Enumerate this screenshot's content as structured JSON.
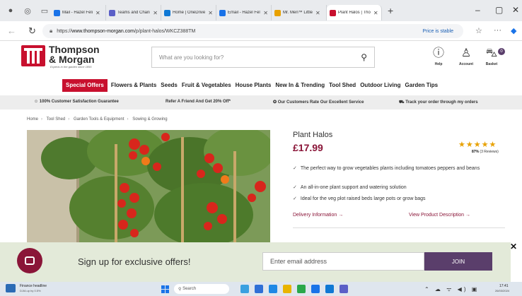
{
  "browser": {
    "tabs": [
      {
        "label": "Mail - Hazel Feli",
        "favicon_color": "#1a73e8",
        "active": false
      },
      {
        "label": "Teams and Chann",
        "favicon_color": "#5b5fc7",
        "active": false
      },
      {
        "label": "Home | OneDrive",
        "favicon_color": "#0f78d4",
        "active": false
      },
      {
        "label": "Email - Hazel Feli",
        "favicon_color": "#1a73e8",
        "active": false
      },
      {
        "label": "Mr. Men™ Little",
        "favicon_color": "#e8a100",
        "active": false
      },
      {
        "label": "Plant Halos | Tho",
        "favicon_color": "#c8102e",
        "active": true
      }
    ],
    "url_prefix": "https://",
    "url_domain": "www.thompson-morgan.com",
    "url_path": "/p/plant-halos/WKCZ388TM",
    "price_note": "Price is stable"
  },
  "site": {
    "brand_line1": "Thompson",
    "brand_line2": "& Morgan",
    "tagline": "Experts in the garden since 1855",
    "search_placeholder": "What are you looking for?",
    "header_icons": [
      {
        "label": "Help",
        "icon": "help-icon"
      },
      {
        "label": "Account",
        "icon": "account-icon"
      },
      {
        "label": "Basket",
        "icon": "basket-icon"
      }
    ],
    "basket_count": "0",
    "nav": [
      "Special Offers",
      "Flowers & Plants",
      "Seeds",
      "Fruit & Vegetables",
      "House Plants",
      "New In & Trending",
      "Tool Shed",
      "Outdoor Living",
      "Garden Tips"
    ],
    "benefits": [
      "100% Customer Satisfaction Guarantee",
      "Refer A Friend And Get 20% Off*",
      "Our Customers Rate Our Excellent Service",
      "Track your order through my orders"
    ],
    "breadcrumbs": [
      "Home",
      "Tool Shed",
      "Garden Tools & Equipment",
      "Sowing & Growing"
    ]
  },
  "product": {
    "title": "Plant Halos",
    "price": "£17.99",
    "stars": "★★★★★",
    "rating_percent": "87%",
    "rating_reviews": "(3 Reviews)",
    "features": [
      "The perfect way to grow vegetables plants including tomatoes peppers and beans",
      "An all-in-one plant support and watering solution",
      "Ideal for the veg plot raised beds large pots or grow bags"
    ],
    "delivery_link": "Delivery Information →",
    "description_link": "View Product Description →"
  },
  "signup": {
    "text": "Sign up for exclusive offers!",
    "email_placeholder": "Enter email address",
    "join_label": "JOIN"
  },
  "taskbar": {
    "news_title": "Finance headline",
    "news_sub": "DJIA up by 0.5%",
    "search_label": "Search",
    "time": "17:41",
    "date": "26/03/2024"
  }
}
